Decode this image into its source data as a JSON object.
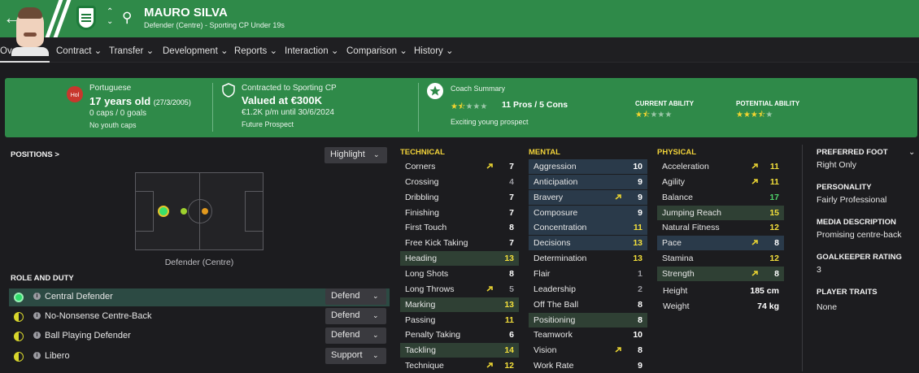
{
  "header": {
    "back_icon": "arrow-left-icon",
    "forward_icon": "arrow-right-icon",
    "player_name": "MAURO SILVA",
    "player_subtitle": "Defender (Centre) - Sporting CP Under 19s"
  },
  "tabs": [
    {
      "label": "Overview"
    },
    {
      "label": "Contract"
    },
    {
      "label": "Transfer"
    },
    {
      "label": "Development"
    },
    {
      "label": "Reports"
    },
    {
      "label": "Interaction"
    },
    {
      "label": "Comparison"
    },
    {
      "label": "History"
    }
  ],
  "banner": {
    "flag_label": "Hol",
    "nationality": "Portuguese",
    "age": "17 years old",
    "dob": "(27/3/2005)",
    "caps": "0 caps / 0 goals",
    "youth_caps": "No youth caps",
    "contract": "Contracted to Sporting CP",
    "valued": "Valued at €300K",
    "wage": "€1.2K p/m until 30/6/2024",
    "prospect": "Future Prospect",
    "coach_title": "Coach Summary",
    "pros_cons": "11 Pros / 5 Cons",
    "coach_note": "Exciting young prospect",
    "coach_stars": 1.5,
    "current_ability_label": "CURRENT ABILITY",
    "current_ability_stars": 1.5,
    "potential_ability_label": "POTENTIAL ABILITY",
    "potential_ability_stars": 3.5
  },
  "positions": {
    "title": "POSITIONS >",
    "highlight_label": "Highlight",
    "position_label": "Defender (Centre)"
  },
  "roles": {
    "title": "ROLE AND DUTY",
    "items": [
      {
        "name": "Central Defender",
        "duty": "Defend"
      },
      {
        "name": "No-Nonsense Centre-Back",
        "duty": "Defend"
      },
      {
        "name": "Ball Playing Defender",
        "duty": "Defend"
      },
      {
        "name": "Libero",
        "duty": "Support"
      }
    ]
  },
  "technical": {
    "title": "TECHNICAL",
    "attrs": [
      {
        "name": "Corners",
        "value": "7"
      },
      {
        "name": "Crossing",
        "value": "4"
      },
      {
        "name": "Dribbling",
        "value": "7"
      },
      {
        "name": "Finishing",
        "value": "7"
      },
      {
        "name": "First Touch",
        "value": "8"
      },
      {
        "name": "Free Kick Taking",
        "value": "7"
      },
      {
        "name": "Heading",
        "value": "13"
      },
      {
        "name": "Long Shots",
        "value": "8"
      },
      {
        "name": "Long Throws",
        "value": "5"
      },
      {
        "name": "Marking",
        "value": "13"
      },
      {
        "name": "Passing",
        "value": "11"
      },
      {
        "name": "Penalty Taking",
        "value": "6"
      },
      {
        "name": "Tackling",
        "value": "14"
      },
      {
        "name": "Technique",
        "value": "12"
      }
    ]
  },
  "mental": {
    "title": "MENTAL",
    "attrs": [
      {
        "name": "Aggression",
        "value": "10"
      },
      {
        "name": "Anticipation",
        "value": "9"
      },
      {
        "name": "Bravery",
        "value": "9"
      },
      {
        "name": "Composure",
        "value": "9"
      },
      {
        "name": "Concentration",
        "value": "11"
      },
      {
        "name": "Decisions",
        "value": "13"
      },
      {
        "name": "Determination",
        "value": "13"
      },
      {
        "name": "Flair",
        "value": "1"
      },
      {
        "name": "Leadership",
        "value": "2"
      },
      {
        "name": "Off The Ball",
        "value": "8"
      },
      {
        "name": "Positioning",
        "value": "8"
      },
      {
        "name": "Teamwork",
        "value": "10"
      },
      {
        "name": "Vision",
        "value": "8"
      },
      {
        "name": "Work Rate",
        "value": "9"
      }
    ]
  },
  "physical": {
    "title": "PHYSICAL",
    "attrs": [
      {
        "name": "Acceleration",
        "value": "11"
      },
      {
        "name": "Agility",
        "value": "11"
      },
      {
        "name": "Balance",
        "value": "17"
      },
      {
        "name": "Jumping Reach",
        "value": "15"
      },
      {
        "name": "Natural Fitness",
        "value": "12"
      },
      {
        "name": "Pace",
        "value": "8"
      },
      {
        "name": "Stamina",
        "value": "12"
      },
      {
        "name": "Strength",
        "value": "8"
      }
    ],
    "height_label": "Height",
    "height_value": "185 cm",
    "weight_label": "Weight",
    "weight_value": "74 kg"
  },
  "profile": {
    "preferred_foot_label": "PREFERRED FOOT",
    "preferred_foot": "Right Only",
    "personality_label": "PERSONALITY",
    "personality": "Fairly Professional",
    "media_label": "MEDIA DESCRIPTION",
    "media": "Promising centre-back",
    "gk_label": "GOALKEEPER RATING",
    "gk": "3",
    "traits_label": "PLAYER TRAITS",
    "traits": "None"
  },
  "colors": {
    "header_green": "#2f8a49",
    "accent_yellow": "#f2d33a",
    "value_yellow": "#f3df3b",
    "value_green": "#4fd36a",
    "value_white": "#ffffff",
    "value_grey": "#9a9aa0"
  }
}
